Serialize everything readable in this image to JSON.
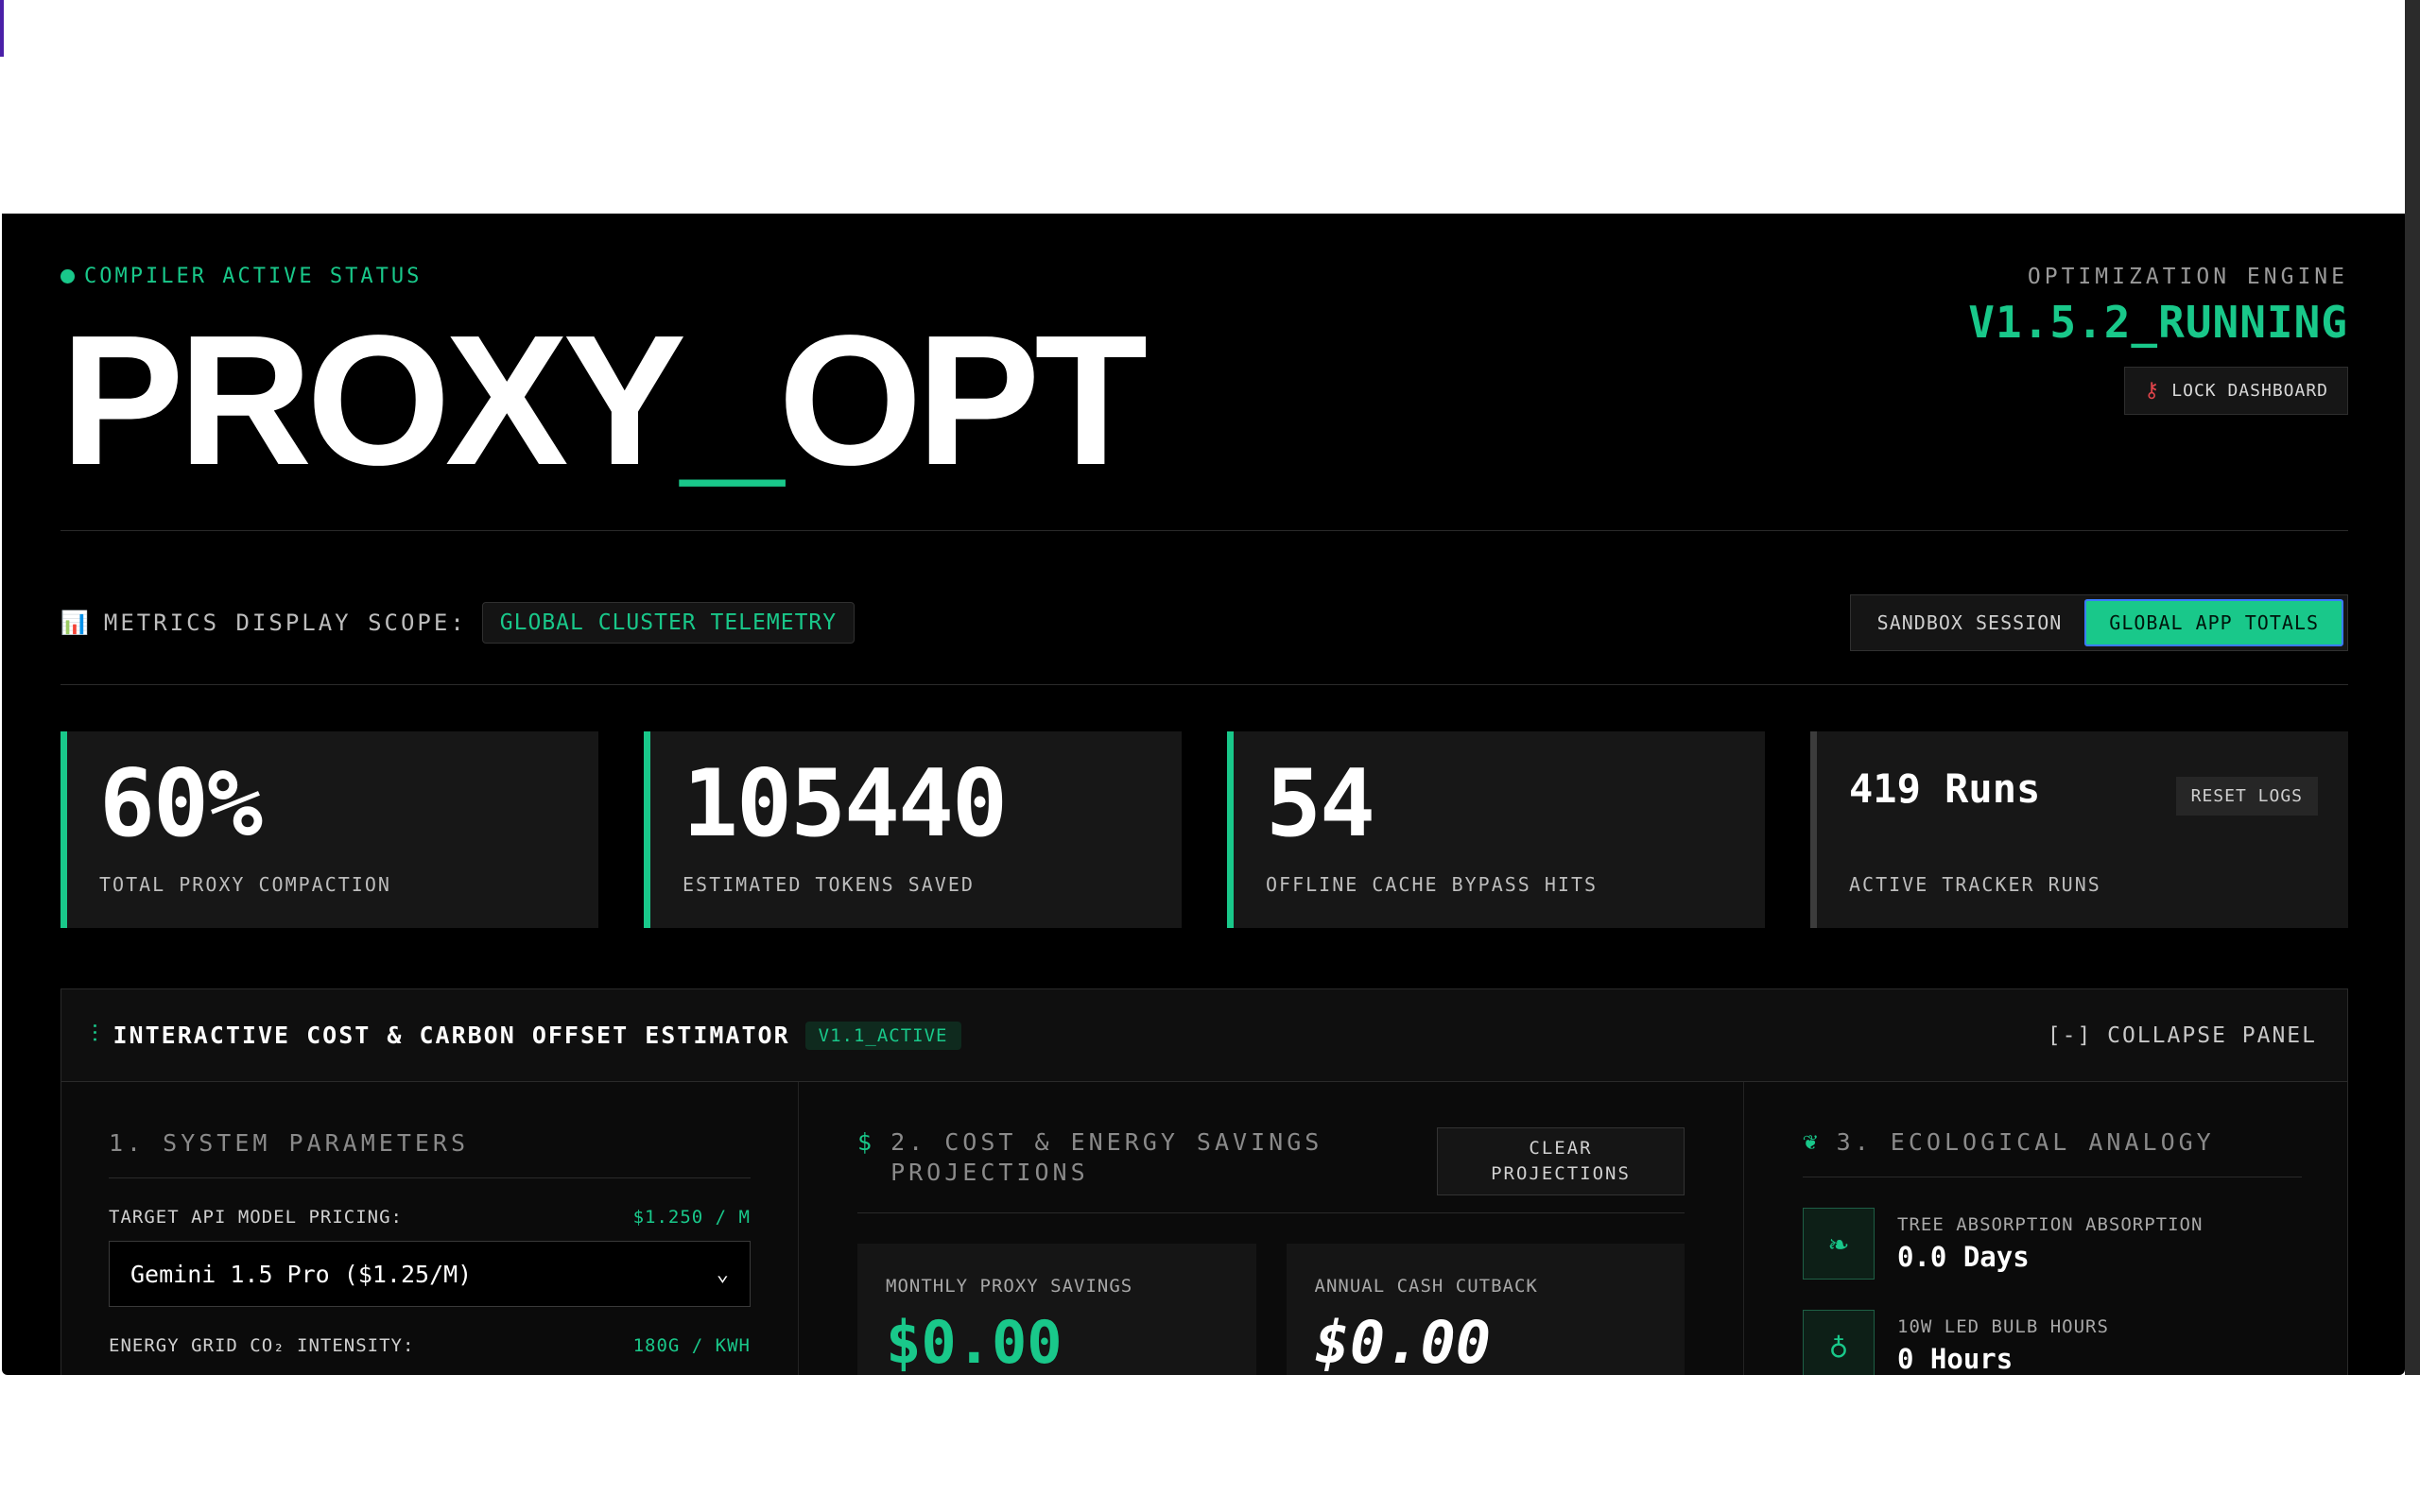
{
  "status": {
    "label": "COMPILER ACTIVE STATUS"
  },
  "brand": {
    "part1": "PROXY",
    "underscore": "_",
    "part2": "OPT"
  },
  "engine": {
    "label": "OPTIMIZATION ENGINE",
    "version": "V1.5.2_RUNNING",
    "lock_label": "LOCK DASHBOARD"
  },
  "scope": {
    "icon": "📊",
    "label": "METRICS DISPLAY SCOPE:",
    "badge": "GLOBAL CLUSTER TELEMETRY",
    "options": [
      "SANDBOX SESSION",
      "GLOBAL APP TOTALS"
    ],
    "active_option": "GLOBAL APP TOTALS"
  },
  "cards": [
    {
      "value": "60%",
      "caption": "TOTAL PROXY COMPACTION"
    },
    {
      "value": "105440",
      "caption": "ESTIMATED TOKENS SAVED"
    },
    {
      "value": "54",
      "caption": "OFFLINE CACHE BYPASS HITS"
    },
    {
      "value": "419 Runs",
      "caption": "ACTIVE TRACKER RUNS",
      "button": "RESET LOGS"
    }
  ],
  "estimator": {
    "title": "INTERACTIVE COST & CARBON OFFSET ESTIMATOR",
    "badge": "V1.1_ACTIVE",
    "collapse": "[-] COLLAPSE PANEL",
    "params": {
      "title": "1. SYSTEM PARAMETERS",
      "pricing_label": "TARGET API MODEL PRICING:",
      "pricing_value": "$1.250 / M",
      "model_selected": "Gemini 1.5 Pro ($1.25/M)",
      "grid_label": "ENERGY GRID CO₂ INTENSITY:",
      "grid_value": "180G / KWH"
    },
    "savings": {
      "title": "2. COST & ENERGY SAVINGS PROJECTIONS",
      "clear_label": "CLEAR PROJECTIONS",
      "monthly_label": "MONTHLY PROXY SAVINGS",
      "monthly_value": "$0.00",
      "annual_label": "ANNUAL CASH CUTBACK",
      "annual_value": "$0.00"
    },
    "eco": {
      "title": "3. ECOLOGICAL ANALOGY",
      "items": [
        {
          "icon": "leaf-icon",
          "caption": "TREE ABSORPTION ABSORPTION",
          "value": "0.0 Days"
        },
        {
          "icon": "lightbulb-icon",
          "caption": "10W LED BULB HOURS",
          "value": "0 Hours"
        }
      ]
    }
  },
  "colors": {
    "accent": "#19c88a",
    "background": "#000000",
    "card": "#171717",
    "danger": "#e0444a"
  }
}
